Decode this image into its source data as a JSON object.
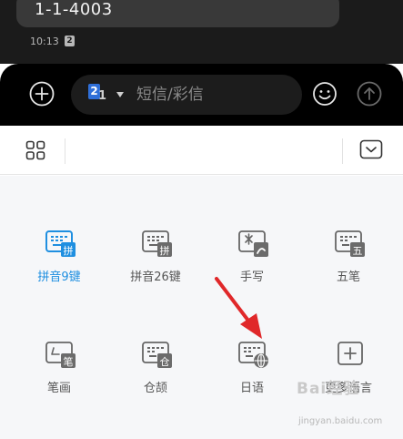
{
  "chat": {
    "message_text": "1-1-4003",
    "timestamp": "10:13",
    "sim_badge": "2"
  },
  "input_bar": {
    "sim_number": "2",
    "sim_sub": "1",
    "placeholder": "短信/彩信",
    "accent_color": "#2f6fd8"
  },
  "keyboard": {
    "active_color": "#1f8fe0",
    "tiles": [
      {
        "label": "拼音9键",
        "icon": "pinyin-9-key-icon",
        "active": true
      },
      {
        "label": "拼音26键",
        "icon": "pinyin-26-key-icon",
        "active": false
      },
      {
        "label": "手写",
        "icon": "handwriting-icon",
        "active": false
      },
      {
        "label": "五笔",
        "icon": "wubi-icon",
        "active": false
      },
      {
        "label": "笔画",
        "icon": "stroke-icon",
        "active": false
      },
      {
        "label": "仓颉",
        "icon": "cangjie-icon",
        "active": false
      },
      {
        "label": "日语",
        "icon": "japanese-icon",
        "active": false
      },
      {
        "label": "更多语言",
        "icon": "more-languages-icon",
        "active": false
      }
    ],
    "icon_glyphs": {
      "pinyin9": "拼",
      "pinyin26": "拼",
      "wubi": "五",
      "stroke": "笔",
      "cangjie": "仓"
    }
  },
  "watermark": {
    "text": "Bai经验",
    "subtext": "jingyan.baidu.com"
  },
  "annotation": {
    "arrow_color": "#e0282a"
  }
}
